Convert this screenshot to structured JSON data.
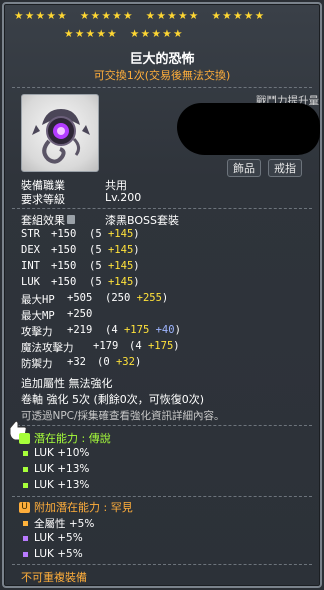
{
  "star_force": {
    "row1": [
      "★★★★★",
      "★★★★★",
      "★★★★★",
      "★★★★★"
    ],
    "row2": [
      "★★★★★",
      "★★★★★"
    ],
    "color": "#ffd733"
  },
  "item": {
    "name": "巨大的恐怖",
    "trade_note": "可交換1次(交易後無法交換)",
    "icon": "purple-eye-pendant-icon",
    "power_label": "戰鬥力提升量",
    "tags": [
      "飾品",
      "戒指"
    ]
  },
  "info": [
    {
      "label": "裝備職業",
      "value": "共用"
    },
    {
      "label": "要求等級",
      "value": "Lv.200"
    }
  ],
  "set": {
    "label": "套組效果",
    "value": "漆黑BOSS套裝"
  },
  "stats": [
    {
      "name": "STR",
      "total": "+150",
      "open": "(",
      "base": "5",
      "plus": "+145",
      "close": ")"
    },
    {
      "name": "DEX",
      "total": "+150",
      "open": "(",
      "base": "5",
      "plus": "+145",
      "close": ")"
    },
    {
      "name": "INT",
      "total": "+150",
      "open": "(",
      "base": "5",
      "plus": "+145",
      "close": ")"
    },
    {
      "name": "LUK",
      "total": "+150",
      "open": "(",
      "base": "5",
      "plus": "+145",
      "close": ")"
    },
    {
      "name": "最大HP",
      "total": "+505",
      "open": "(",
      "base": "250",
      "plus": "+255",
      "close": ")"
    },
    {
      "name": "最大MP",
      "total": "+250",
      "open": "",
      "base": "",
      "plus": "",
      "close": ""
    },
    {
      "name": "攻擊力",
      "total": "+219",
      "open": "(",
      "base": "4",
      "plus": "+175",
      "extra": "+40",
      "close": ")"
    },
    {
      "name": "魔法攻擊力",
      "total": "+179",
      "open": "(",
      "base": "4",
      "plus": "+175",
      "close": ")"
    },
    {
      "name": "防禦力",
      "total": "+32",
      "open": "(",
      "base": "0",
      "plus": "+32",
      "close": ")"
    }
  ],
  "extra": {
    "add_prop": "追加屬性 無法強化",
    "scroll": "卷軸 強化 5次 (剩餘0次，可恢復0次)",
    "hint": "可透過NPC/採集確查看強化資訊詳細內容。"
  },
  "potential": {
    "header": "潛在能力 : 傳說",
    "lines": [
      "LUK +10%",
      "LUK +13%",
      "LUK +13%"
    ],
    "color": "#a7ff3a"
  },
  "bonus_potential": {
    "header": "附加潛在能力 : 罕見",
    "lines": [
      "全屬性 +5%",
      "LUK +5%",
      "LUK +5%"
    ],
    "color": "#ffae3b"
  },
  "footer": "不可重複裝備"
}
